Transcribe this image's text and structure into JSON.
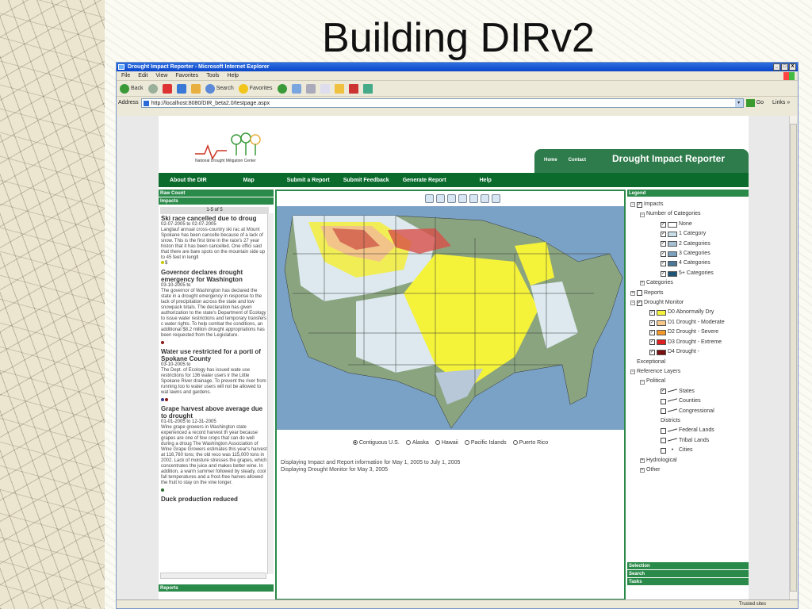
{
  "slide_title": "Building DIRv2",
  "window": {
    "title": "Drought Impact Reporter - Microsoft Internet Explorer",
    "buttons": [
      "_",
      "□",
      "X"
    ]
  },
  "menu": [
    "File",
    "Edit",
    "View",
    "Favorites",
    "Tools",
    "Help"
  ],
  "toolbar": {
    "back": "Back",
    "search": "Search",
    "favorites": "Favorites"
  },
  "address": {
    "label": "Address",
    "url": "http://localhost:8080/DIR_beta2.0/testpage.aspx",
    "go": "Go",
    "links": "Links »"
  },
  "status": {
    "zone": "Trusted sites"
  },
  "header": {
    "logo_text": "National Drought Mitigation Center",
    "home": "Home",
    "contact": "Contact",
    "title": "Drought Impact Reporter"
  },
  "nav": [
    "About the DIR",
    "Map",
    "Submit a Report",
    "Submit Feedback",
    "Generate Report",
    "Help"
  ],
  "left": {
    "raw_count": "Raw Count",
    "impacts": "Impacts",
    "pager": "1-5 of 5",
    "reports": "Reports",
    "items": [
      {
        "title": "Ski race cancelled due to droug",
        "date": "02-07-2005 to 02-07-2005",
        "body": "Langlauf annual cross-country ski rac at Mount Spokane has been cancelle because of a lack of snow. This is the first time in the race's 27 year histon that it has been cancelled. One offici said that there are bare spots on the mountain side up to 45 feet in lengtl",
        "tag": "$"
      },
      {
        "title": "Governor declares drought emergency for Washington",
        "date": "03-10-2005 to",
        "body": "The governor of Washington has declared the state in a drought emergency in response to the lack of precipitation across the state and low snowpack totals. The declaration has given authorization to the state's Department of Ecology to issue water restrictions and temporary transfers c water rights. To help combat the conditions, an additional $8.2 million drought appropriations has been requested from the Legislature.",
        "tag": ""
      },
      {
        "title": "Water use restricted for a porti of Spokane County",
        "date": "03-10-2005 to",
        "body": "The Dept. of Ecology has issued wate use restrictions for 136 water users ir the Little Spokane River drainage. To prevent the river from running too lo water users will not be allowed to wat lawns and gardens.",
        "tag": ""
      },
      {
        "title": "Grape harvest above average due to drought",
        "date": "01-01-2005 to 12-31-2005",
        "body": "Wine grape growers in Washington state experienced a record harvest th year because grapes are one of few crops that can do well during a droug The Washington Association of Wine Grape Growers estimates this year's harvest at 116,760 tons; the old reco was 115,000 tons in 2002. Lack of moisture stresses the grapes, which concentrates the juice and makes better wine. In addition, a warm summer followed by steady, cool fall temperatures and a frost-free harves allowed the fruit to stay on the vine longer.",
        "tag": ""
      },
      {
        "title": "Duck production reduced",
        "date": "",
        "body": "",
        "tag": ""
      }
    ]
  },
  "map": {
    "regions": [
      "Contiguous U.S.",
      "Alaska",
      "Hawaii",
      "Pacific Islands",
      "Puerto Rico"
    ],
    "info": [
      "Displaying Impact and Report information for May 1, 2005 to July 1, 2005",
      "Displaying Drought Monitor for May 3, 2005"
    ]
  },
  "legend": {
    "title": "Legend",
    "impacts": "Impacts",
    "num_categories": "Number of Categories",
    "categories": [
      {
        "label": "None",
        "color": "#ffffff"
      },
      {
        "label": "1 Category",
        "color": "#c9dde8"
      },
      {
        "label": "2 Categories",
        "color": "#a6c0d2"
      },
      {
        "label": "3 Categories",
        "color": "#7c9fba"
      },
      {
        "label": "4 Categories",
        "color": "#4d7796"
      },
      {
        "label": "5+ Categories",
        "color": "#1f5475"
      }
    ],
    "categories_node": "Categories",
    "reports": "Reports",
    "drought_monitor": "Drought Monitor",
    "dm": [
      {
        "label": "D0 Abnormally Dry",
        "color": "#f5f23a"
      },
      {
        "label": "D1 Drought - Moderate",
        "color": "#f8c88a"
      },
      {
        "label": "D2 Drought - Severe",
        "color": "#f29a2c"
      },
      {
        "label": "D3 Drought - Extreme",
        "color": "#e02020"
      },
      {
        "label": "D4 Drought -",
        "color": "#7a1010"
      }
    ],
    "dm_exceptional": "Exceptional",
    "reference_layers": "Reference Layers",
    "political": "Political",
    "political_layers": [
      {
        "label": "States",
        "checked": true
      },
      {
        "label": "Counties",
        "checked": false
      },
      {
        "label": "Congressional",
        "checked": false
      },
      {
        "label": "Federal Lands",
        "checked": false
      },
      {
        "label": "Tribal Lands",
        "checked": false
      },
      {
        "label": "Cities",
        "checked": false
      }
    ],
    "districts": "Districts",
    "hydrological": "Hydrological",
    "other": "Other"
  },
  "right_bottom": [
    "Selection",
    "Search",
    "Tasks"
  ]
}
